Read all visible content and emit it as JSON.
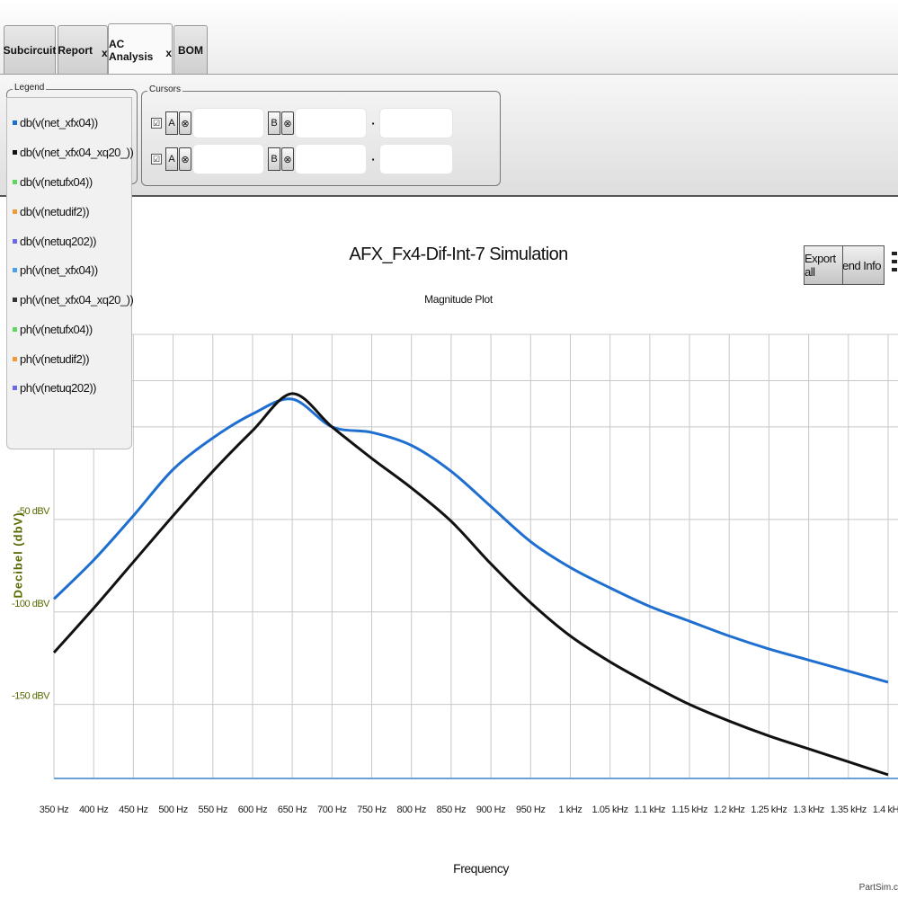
{
  "tabs": [
    {
      "label": "Subcircuit",
      "closable": false,
      "active": false
    },
    {
      "label": "Report",
      "closable": true,
      "active": false
    },
    {
      "label": "AC Analysis",
      "closable": true,
      "active": true
    },
    {
      "label": "BOM",
      "closable": false,
      "active": false
    }
  ],
  "close_glyph": "x",
  "legend": {
    "title": "Legend",
    "items": [
      {
        "label": "db(v(net_xfx04))",
        "color": "#1f6fd1"
      },
      {
        "label": "db(v(net_xfx04_xq20_))",
        "color": "#111111"
      },
      {
        "label": "db(v(netufx04))",
        "color": "#5fd65f"
      },
      {
        "label": "db(v(netudif2))",
        "color": "#f09a3a"
      },
      {
        "label": "db(v(netuq202))",
        "color": "#6a6ae6"
      },
      {
        "label": "ph(v(net_xfx04))",
        "color": "#4aa0ea"
      },
      {
        "label": "ph(v(net_xfx04_xq20_))",
        "color": "#333333"
      },
      {
        "label": "ph(v(netufx04))",
        "color": "#5fd65f"
      },
      {
        "label": "ph(v(netudif2))",
        "color": "#f09a3a"
      },
      {
        "label": "ph(v(netuq202))",
        "color": "#6a6ae6"
      }
    ]
  },
  "cursors": {
    "title": "Cursors",
    "rows": [
      {
        "a_label": "A",
        "b_label": "B",
        "x_glyph": "⊗",
        "check": "☑",
        "sep": "▪"
      },
      {
        "a_label": "A",
        "b_label": "B",
        "x_glyph": "⊗",
        "check": "☑",
        "sep": "▪"
      }
    ]
  },
  "buttons": {
    "export_all": "Export all",
    "legend_info": "Legend Info"
  },
  "footer": "PartSim.c",
  "chart_data": {
    "type": "line",
    "title": "AFX_Fx4-Dif-Int-7 Simulation",
    "subtitle": "Magnitude Plot",
    "xlabel": "Frequency",
    "ylabel": "Decibel (dbV)",
    "xlim": [
      350,
      1400
    ],
    "ylim": [
      -190,
      50
    ],
    "x_ticks": [
      350,
      400,
      450,
      500,
      550,
      600,
      650,
      700,
      750,
      800,
      850,
      900,
      950,
      1000,
      1050,
      1100,
      1150,
      1200,
      1250,
      1300,
      1350,
      1400
    ],
    "x_tick_labels": [
      "350 Hz",
      "400 Hz",
      "450 Hz",
      "500 Hz",
      "550 Hz",
      "600 Hz",
      "650 Hz",
      "700 Hz",
      "750 Hz",
      "800 Hz",
      "850 Hz",
      "900 Hz",
      "950 Hz",
      "1 kHz",
      "1.05 kHz",
      "1.1 kHz",
      "1.15 kHz",
      "1.2 kHz",
      "1.25 kHz",
      "1.3 kHz",
      "1.35 kHz",
      "1.4 kHz"
    ],
    "y_ticks": [
      -150,
      -100,
      -50
    ],
    "y_tick_labels": [
      "-150 dBV",
      "-100 dBV",
      "-50 dBV"
    ],
    "grid": true,
    "series": [
      {
        "name": "db(v(net_xfx04))",
        "color": "#1f6fd1",
        "x": [
          350,
          400,
          450,
          500,
          550,
          600,
          650,
          700,
          750,
          800,
          850,
          900,
          950,
          1000,
          1050,
          1100,
          1150,
          1200,
          1250,
          1300,
          1350,
          1400
        ],
        "y": [
          -93,
          -72,
          -48,
          -23,
          -6,
          7,
          15,
          0,
          -3,
          -10,
          -24,
          -43,
          -62,
          -76,
          -87,
          -97,
          -105,
          -113,
          -120,
          -126,
          -132,
          -138
        ]
      },
      {
        "name": "db(v(net_xfx04_xq20_))",
        "color": "#111111",
        "x": [
          350,
          400,
          450,
          500,
          550,
          600,
          650,
          700,
          750,
          800,
          850,
          900,
          950,
          1000,
          1050,
          1100,
          1150,
          1200,
          1250,
          1300,
          1350,
          1400
        ],
        "y": [
          -122,
          -98,
          -73,
          -48,
          -24,
          -2,
          18,
          0,
          -17,
          -33,
          -51,
          -74,
          -95,
          -113,
          -127,
          -139,
          -150,
          -159,
          -167,
          -174,
          -181,
          -188
        ]
      }
    ]
  }
}
